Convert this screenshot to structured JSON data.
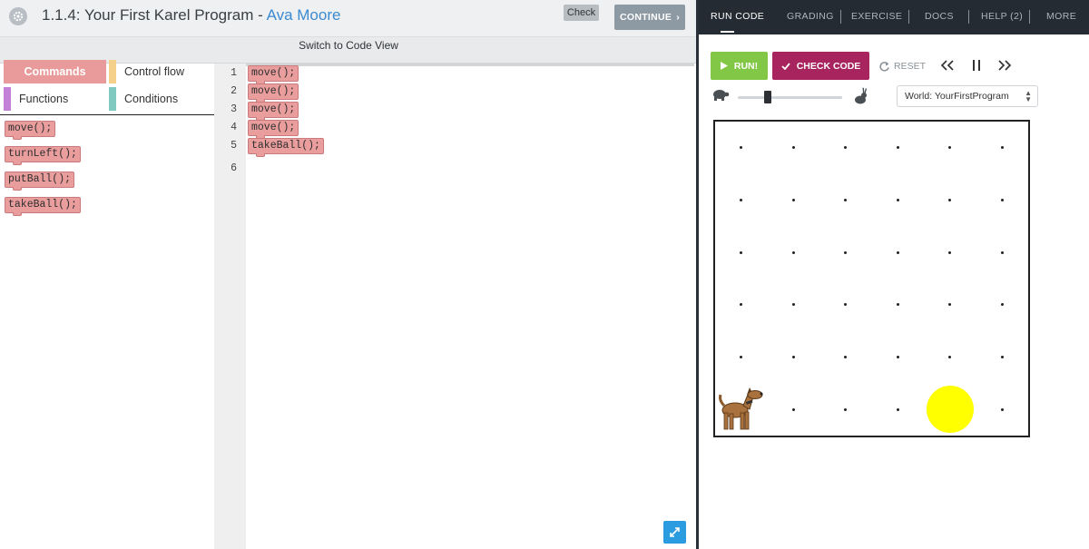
{
  "header": {
    "title": "1.1.4: Your First Karel Program - ",
    "student": "Ava Moore",
    "check_label": "Check",
    "continue_label": "CONTINUE"
  },
  "switch_view_label": "Switch to Code View",
  "toolbox": {
    "categories": [
      {
        "label": "Commands",
        "color": "#e99b9b"
      },
      {
        "label": "Control flow",
        "color": "#f5d08a"
      },
      {
        "label": "Functions",
        "color": "#c47fd6"
      },
      {
        "label": "Conditions",
        "color": "#7fc9c0"
      }
    ],
    "blocks": [
      "move();",
      "turnLeft();",
      "putBall();",
      "takeBall();"
    ]
  },
  "editor": {
    "line_numbers": [
      "1",
      "2",
      "3",
      "4",
      "5",
      "6"
    ],
    "code": [
      "move();",
      "move();",
      "move();",
      "move();",
      "takeBall();"
    ]
  },
  "right_nav": {
    "items": [
      "RUN CODE",
      "GRADING",
      "EXERCISE",
      "DOCS",
      "HELP (2)",
      "MORE"
    ],
    "active": "RUN CODE"
  },
  "controls": {
    "run_label": "RUN!",
    "check_code_label": "CHECK CODE",
    "reset_label": "RESET",
    "speed_level": 0.3,
    "world_select_value": "World: YourFirstProgram"
  },
  "world": {
    "cols": 6,
    "rows": 6,
    "karel": {
      "col": 1,
      "row": 1,
      "facing": "east"
    },
    "balls": [
      {
        "col": 5,
        "row": 1
      }
    ]
  },
  "colors": {
    "command_block": "#ea9d9d",
    "run_green": "#82c846",
    "check_code_magenta": "#a8245e",
    "nav_bg": "#242b33",
    "ball_yellow": "#ffff00"
  }
}
